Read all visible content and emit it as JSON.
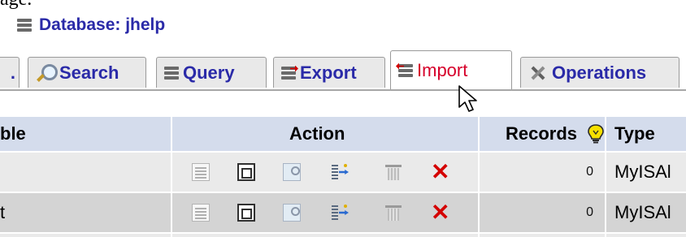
{
  "caption_fragment": "age.",
  "header": {
    "label": "Database: jhelp"
  },
  "tabs": [
    {
      "id": "sliver",
      "label": "."
    },
    {
      "id": "search",
      "label": "Search",
      "icon": "search-icon"
    },
    {
      "id": "query",
      "label": "Query",
      "icon": "database-icon"
    },
    {
      "id": "export",
      "label": "Export",
      "icon": "export-icon"
    },
    {
      "id": "import",
      "label": "Import",
      "icon": "import-icon",
      "active": true
    },
    {
      "id": "operations",
      "label": "Operations",
      "icon": "operations-icon"
    }
  ],
  "table": {
    "columns": [
      "ble",
      "Action",
      "Records",
      "Type"
    ],
    "records_icon": "lightbulb-icon",
    "action_icons": [
      "browse-icon",
      "structure-icon",
      "search-icon",
      "insert-icon",
      "empty-icon",
      "drop-icon"
    ],
    "rows": [
      {
        "name": "",
        "records": "0",
        "type": "MyISAl"
      },
      {
        "name": "t",
        "records": "0",
        "type": "MyISAl"
      }
    ]
  },
  "colors": {
    "link": "#2a2aa8",
    "active_tab": "#d6002a",
    "header_bg": "#d4dcec",
    "row_odd": "#eaeaea",
    "row_even": "#d4d4d4",
    "drop_red": "#d40000"
  }
}
